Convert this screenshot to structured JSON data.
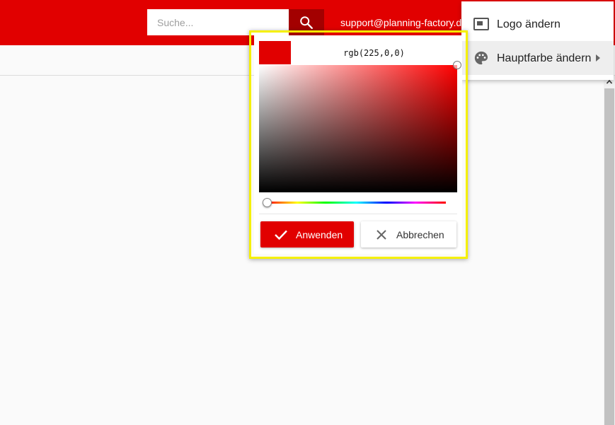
{
  "header": {
    "search": {
      "placeholder": "Suche...",
      "value": ""
    },
    "support_email": "support@planning-factory.de"
  },
  "menu": {
    "items": [
      {
        "label": "Logo ändern",
        "icon": "picture-in-picture-icon"
      },
      {
        "label": "Hauptfarbe ändern",
        "icon": "palette-icon",
        "has_submenu": true
      }
    ]
  },
  "color_picker": {
    "value": "rgb(225,0,0)",
    "apply_label": "Anwenden",
    "cancel_label": "Abbrechen"
  },
  "colors": {
    "brand_red": "#e10000",
    "search_button": "#a30000",
    "highlight_outline": "#f5f000"
  }
}
